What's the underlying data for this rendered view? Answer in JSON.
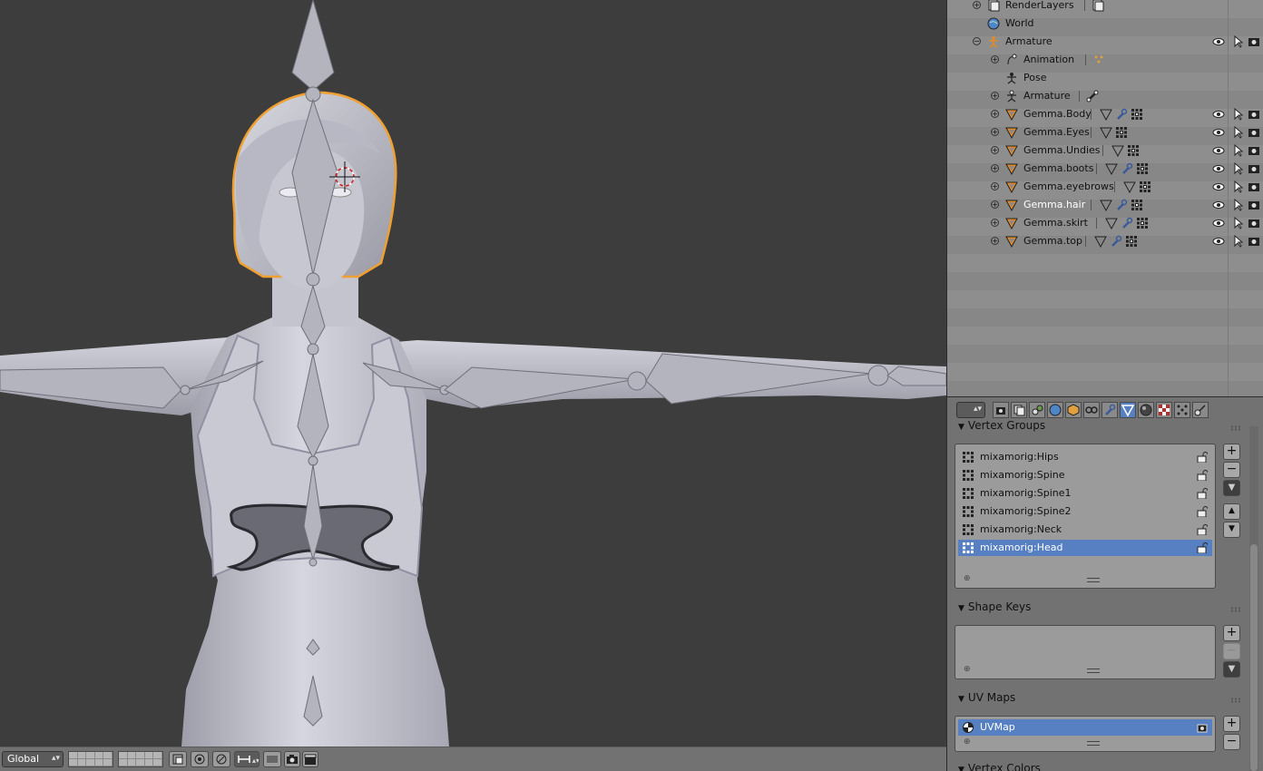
{
  "viewport": {
    "header": {
      "orientation": "Global",
      "orientation_icon": "up-down-arrows-icon"
    }
  },
  "outliner": {
    "rows": [
      {
        "label": "RenderLayers",
        "icon": "render-layers-icon",
        "expand": "+",
        "highlight": false
      },
      {
        "label": "World",
        "icon": "world-icon",
        "expand": "",
        "highlight": false
      },
      {
        "label": "Armature",
        "icon": "armature-object-icon",
        "expand": "−",
        "highlight": false
      },
      {
        "label": "Animation",
        "icon": "animation-icon",
        "expand": "+",
        "highlight": false
      },
      {
        "label": "Pose",
        "icon": "pose-icon",
        "expand": "",
        "highlight": false
      },
      {
        "label": "Armature",
        "icon": "armature-data-icon",
        "expand": "+",
        "highlight": false
      },
      {
        "label": "Gemma.Body",
        "icon": "mesh-object-icon",
        "expand": "+",
        "highlight": false
      },
      {
        "label": "Gemma.Eyes",
        "icon": "mesh-object-icon",
        "expand": "+",
        "highlight": false
      },
      {
        "label": "Gemma.Undies",
        "icon": "mesh-object-icon",
        "expand": "+",
        "highlight": false
      },
      {
        "label": "Gemma.boots",
        "icon": "mesh-object-icon",
        "expand": "+",
        "highlight": false
      },
      {
        "label": "Gemma.eyebrows",
        "icon": "mesh-object-icon",
        "expand": "+",
        "highlight": false
      },
      {
        "label": "Gemma.hair",
        "icon": "mesh-object-icon",
        "expand": "+",
        "highlight": true
      },
      {
        "label": "Gemma.skirt",
        "icon": "mesh-object-icon",
        "expand": "+",
        "highlight": false
      },
      {
        "label": "Gemma.top",
        "icon": "mesh-object-icon",
        "expand": "+",
        "highlight": false
      }
    ]
  },
  "properties": {
    "tabs": [
      "render-icon",
      "render-layers-icon",
      "scene-icon",
      "world-icon",
      "object-icon",
      "constraints-icon",
      "modifiers-icon",
      "data-icon",
      "material-icon",
      "texture-icon",
      "particles-icon",
      "physics-icon"
    ],
    "active_tab": 7,
    "vertex_groups": {
      "title": "Vertex Groups",
      "items": [
        "mixamorig:Hips",
        "mixamorig:Spine",
        "mixamorig:Spine1",
        "mixamorig:Spine2",
        "mixamorig:Neck",
        "mixamorig:Head"
      ],
      "selected": 5
    },
    "shape_keys": {
      "title": "Shape Keys"
    },
    "uv_maps": {
      "title": "UV Maps",
      "items": [
        "UVMap"
      ],
      "selected": 0
    },
    "vertex_colors": {
      "title": "Vertex Colors"
    },
    "buttons": {
      "add": "+",
      "remove": "−",
      "menu": "▼",
      "up": "▲",
      "down": "▼"
    }
  },
  "colors": {
    "selection_blue": "#5680c2",
    "selected_outline_orange": "#f0a030",
    "mesh_gray": "#c2c2cc",
    "viewport_bg": "#3d3d3d"
  }
}
